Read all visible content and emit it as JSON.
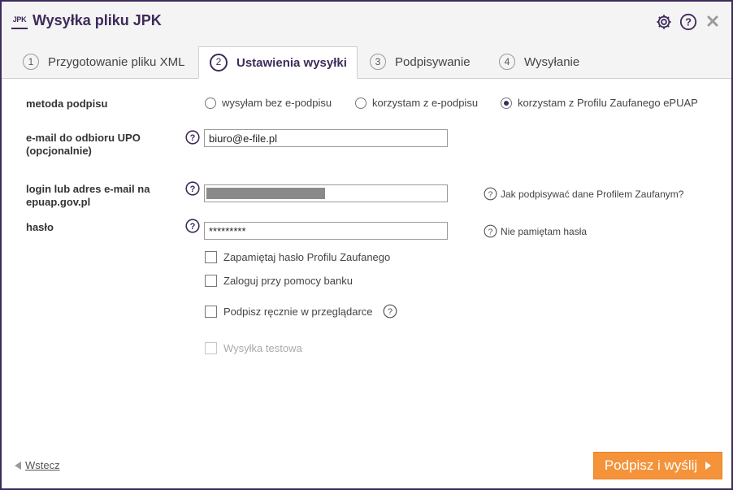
{
  "window": {
    "logo_text": "JPK",
    "title": "Wysyłka pliku JPK"
  },
  "tabs": [
    {
      "num": "1",
      "label": "Przygotowanie pliku XML"
    },
    {
      "num": "2",
      "label": "Ustawienia wysyłki"
    },
    {
      "num": "3",
      "label": "Podpisywanie"
    },
    {
      "num": "4",
      "label": "Wysyłanie"
    }
  ],
  "form": {
    "signature_method": {
      "label": "metoda podpisu",
      "options": [
        {
          "label": "wysyłam bez e-podpisu",
          "selected": false
        },
        {
          "label": "korzystam z e-podpisu",
          "selected": false
        },
        {
          "label": "korzystam z Profilu Zaufanego ePUAP",
          "selected": true
        }
      ]
    },
    "email_upo": {
      "label_line1": "e-mail do odbioru UPO",
      "label_line2": "(opcjonalnie)",
      "value": "biuro@e-file.pl"
    },
    "login": {
      "label_line1": "login lub adres e-mail na",
      "label_line2": "epuap.gov.pl",
      "help_link": "Jak podpisywać dane Profilem Zaufanym?"
    },
    "password": {
      "label": "hasło",
      "value": "*********",
      "help_link": "Nie pamiętam hasła"
    },
    "checkboxes": {
      "remember": "Zapamiętaj hasło Profilu Zaufanego",
      "bank_login": "Zaloguj przy pomocy banku",
      "manual_sign": "Podpisz ręcznie w przeglądarce",
      "test_send": "Wysyłka testowa"
    }
  },
  "footer": {
    "back_label": "Wstecz",
    "primary_label": "Podpisz i wyślij"
  },
  "colors": {
    "brand": "#3d2b5a",
    "primary_button": "#f5933a"
  }
}
